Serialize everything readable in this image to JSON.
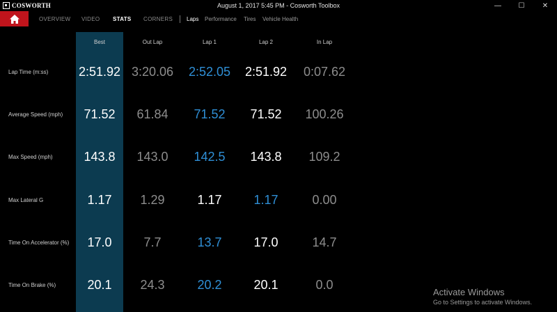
{
  "app": {
    "brand": "COSWORTH",
    "window_title": "August 1, 2017 5:45 PM - Cosworth Toolbox",
    "controls": {
      "minimize": "—",
      "maximize": "☐",
      "close": "✕"
    }
  },
  "nav": {
    "home_icon": "home-icon",
    "items": [
      {
        "label": "OVERVIEW",
        "active": false
      },
      {
        "label": "VIDEO",
        "active": false
      },
      {
        "label": "STATS",
        "active": true
      },
      {
        "label": "CORNERS",
        "active": false
      }
    ],
    "subtabs": [
      {
        "label": "Laps",
        "active": true
      },
      {
        "label": "Performance",
        "active": false
      },
      {
        "label": "Tires",
        "active": false
      },
      {
        "label": "Vehicle Health",
        "active": false
      }
    ]
  },
  "table": {
    "columns": [
      "Best",
      "Out Lap",
      "Lap 1",
      "Lap 2",
      "In Lap"
    ],
    "rows": [
      {
        "label": "Lap Time (m:ss)",
        "values": [
          "2:51.92",
          "3:20.06",
          "2:52.05",
          "2:51.92",
          "0:07.62"
        ],
        "colors": [
          "white",
          "gray",
          "blue",
          "white",
          "gray"
        ]
      },
      {
        "label": "Average Speed (mph)",
        "values": [
          "71.52",
          "61.84",
          "71.52",
          "71.52",
          "100.26"
        ],
        "colors": [
          "white",
          "gray",
          "blue",
          "white",
          "gray"
        ]
      },
      {
        "label": "Max Speed (mph)",
        "values": [
          "143.8",
          "143.0",
          "142.5",
          "143.8",
          "109.2"
        ],
        "colors": [
          "white",
          "gray",
          "blue",
          "white",
          "gray"
        ]
      },
      {
        "label": "Max Lateral G",
        "values": [
          "1.17",
          "1.29",
          "1.17",
          "1.17",
          "0.00"
        ],
        "colors": [
          "white",
          "gray",
          "white",
          "blue",
          "gray"
        ]
      },
      {
        "label": "Time On Accelerator (%)",
        "values": [
          "17.0",
          "7.7",
          "13.7",
          "17.0",
          "14.7"
        ],
        "colors": [
          "white",
          "gray",
          "blue",
          "white",
          "gray"
        ]
      },
      {
        "label": "Time On Brake (%)",
        "values": [
          "20.1",
          "24.3",
          "20.2",
          "20.1",
          "0.0"
        ],
        "colors": [
          "white",
          "gray",
          "blue",
          "white",
          "gray"
        ]
      }
    ]
  },
  "colors": {
    "home_red": "#c0141c",
    "best_column": "#0c3b50",
    "blue_value": "#2f8fd6",
    "gray_value": "#8d8d8d"
  },
  "watermark": {
    "title": "Activate Windows",
    "subtitle": "Go to Settings to activate Windows."
  }
}
